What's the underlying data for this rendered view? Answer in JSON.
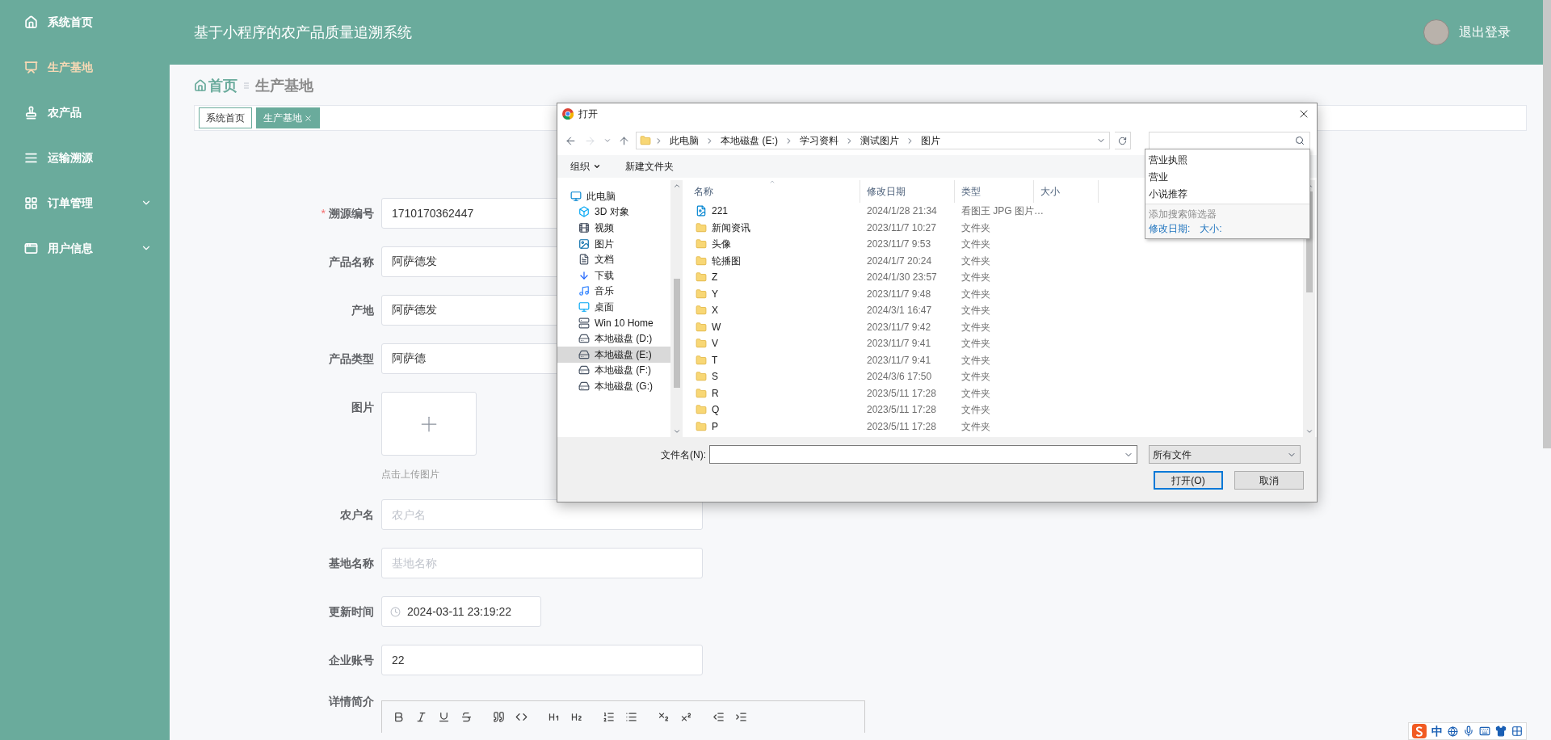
{
  "sidebar": {
    "items": [
      {
        "label": "系统首页",
        "kind": "home",
        "selected": false,
        "expandable": false
      },
      {
        "label": "生产基地",
        "kind": "board",
        "selected": true,
        "expandable": false
      },
      {
        "label": "农产品",
        "kind": "stamp",
        "selected": false,
        "expandable": false
      },
      {
        "label": "运输溯源",
        "kind": "list",
        "selected": false,
        "expandable": false
      },
      {
        "label": "订单管理",
        "kind": "grid",
        "selected": false,
        "expandable": true
      },
      {
        "label": "用户信息",
        "kind": "card",
        "selected": false,
        "expandable": true
      }
    ]
  },
  "header": {
    "title": "基于小程序的农产品质量追溯系统",
    "logout": "退出登录"
  },
  "breadcrumb": {
    "home": "首页",
    "current": "生产基地"
  },
  "tabs": [
    {
      "label": "系统首页",
      "selected": false,
      "closable": false
    },
    {
      "label": "生产基地",
      "selected": true,
      "closable": true
    }
  ],
  "form": {
    "fields": [
      {
        "kind": "text",
        "label": "溯源编号",
        "required_mark": "*",
        "value": "1710170362447"
      },
      {
        "kind": "text",
        "label": "产品名称",
        "value": "阿萨德发"
      },
      {
        "kind": "text",
        "label": "产地",
        "value": "阿萨德发"
      },
      {
        "kind": "text",
        "label": "产品类型",
        "value": "阿萨德"
      },
      {
        "kind": "image",
        "label": "图片",
        "hint": "点击上传图片"
      },
      {
        "kind": "text",
        "label": "农户名",
        "placeholder": "农户名"
      },
      {
        "kind": "text",
        "label": "基地名称",
        "placeholder": "基地名称"
      },
      {
        "kind": "datetime",
        "label": "更新时间",
        "value": "2024-03-11 23:19:22"
      },
      {
        "kind": "text",
        "label": "企业账号",
        "value": "22"
      },
      {
        "kind": "editor",
        "label": "详情简介",
        "toolbar": [
          {
            "kind": "bold"
          },
          {
            "kind": "italic"
          },
          {
            "kind": "underline"
          },
          {
            "kind": "strike"
          },
          {
            "kind": "quote"
          },
          {
            "kind": "code"
          },
          {
            "kind": "h1"
          },
          {
            "kind": "h2"
          },
          {
            "kind": "ordered-list"
          },
          {
            "kind": "bullet-list"
          },
          {
            "kind": "subscript"
          },
          {
            "kind": "superscript"
          },
          {
            "kind": "outdent"
          },
          {
            "kind": "indent"
          }
        ]
      }
    ]
  },
  "file_dialog": {
    "title": "打开",
    "path": [
      "此电脑",
      "本地磁盘 (E:)",
      "学习资料",
      "测试图片",
      "图片"
    ],
    "organize": "组织",
    "new_folder": "新建文件夹",
    "nav": [
      {
        "label": "此电脑",
        "kind": "computer",
        "selected": false,
        "children": [
          {
            "label": "3D 对象",
            "kind": "cube",
            "selected": false
          },
          {
            "label": "视频",
            "kind": "film",
            "selected": false
          },
          {
            "label": "图片",
            "kind": "image",
            "selected": false
          },
          {
            "label": "文档",
            "kind": "doc",
            "selected": false
          },
          {
            "label": "下载",
            "kind": "download",
            "selected": false
          },
          {
            "label": "音乐",
            "kind": "music",
            "selected": false
          },
          {
            "label": "桌面",
            "kind": "desktop",
            "selected": false
          },
          {
            "label": "Win 10 Home",
            "kind": "netdrive",
            "selected": false
          },
          {
            "label": "本地磁盘 (D:)",
            "kind": "drive",
            "selected": false
          },
          {
            "label": "本地磁盘 (E:)",
            "kind": "drive",
            "selected": true
          },
          {
            "label": "本地磁盘 (F:)",
            "kind": "drive",
            "selected": false
          },
          {
            "label": "本地磁盘 (G:)",
            "kind": "drive",
            "selected": false
          }
        ]
      }
    ],
    "columns": [
      "名称",
      "修改日期",
      "类型",
      "大小"
    ],
    "files": [
      {
        "kind": "jpg",
        "name": "221",
        "modified": "2024/1/28 21:34",
        "type": "看图王 JPG 图片…"
      },
      {
        "kind": "folder",
        "name": "新闻资讯",
        "modified": "2023/11/7 10:27",
        "type": "文件夹"
      },
      {
        "kind": "folder",
        "name": "头像",
        "modified": "2023/11/7 9:53",
        "type": "文件夹"
      },
      {
        "kind": "folder",
        "name": "轮播图",
        "modified": "2024/1/7 20:24",
        "type": "文件夹"
      },
      {
        "kind": "folder",
        "name": "Z",
        "modified": "2024/1/30 23:57",
        "type": "文件夹"
      },
      {
        "kind": "folder",
        "name": "Y",
        "modified": "2023/11/7 9:48",
        "type": "文件夹"
      },
      {
        "kind": "folder",
        "name": "X",
        "modified": "2024/3/1 16:47",
        "type": "文件夹"
      },
      {
        "kind": "folder",
        "name": "W",
        "modified": "2023/11/7 9:42",
        "type": "文件夹"
      },
      {
        "kind": "folder",
        "name": "V",
        "modified": "2023/11/7 9:41",
        "type": "文件夹"
      },
      {
        "kind": "folder",
        "name": "T",
        "modified": "2023/11/7 9:41",
        "type": "文件夹"
      },
      {
        "kind": "folder",
        "name": "S",
        "modified": "2024/3/6 17:50",
        "type": "文件夹"
      },
      {
        "kind": "folder",
        "name": "R",
        "modified": "2023/5/11 17:28",
        "type": "文件夹"
      },
      {
        "kind": "folder",
        "name": "Q",
        "modified": "2023/5/11 17:28",
        "type": "文件夹"
      },
      {
        "kind": "folder",
        "name": "P",
        "modified": "2023/5/11 17:28",
        "type": "文件夹"
      }
    ],
    "filename_label": "文件名(N):",
    "filter": "所有文件",
    "open_button": "打开(O)",
    "cancel_button": "取消",
    "search_suggestions": [
      "营业执照",
      "营业",
      "小说推荐"
    ],
    "search_filter_title": "添加搜索筛选器",
    "search_filters": [
      "修改日期:",
      "大小:"
    ]
  },
  "ime_toolbar": {
    "mode": "中"
  }
}
